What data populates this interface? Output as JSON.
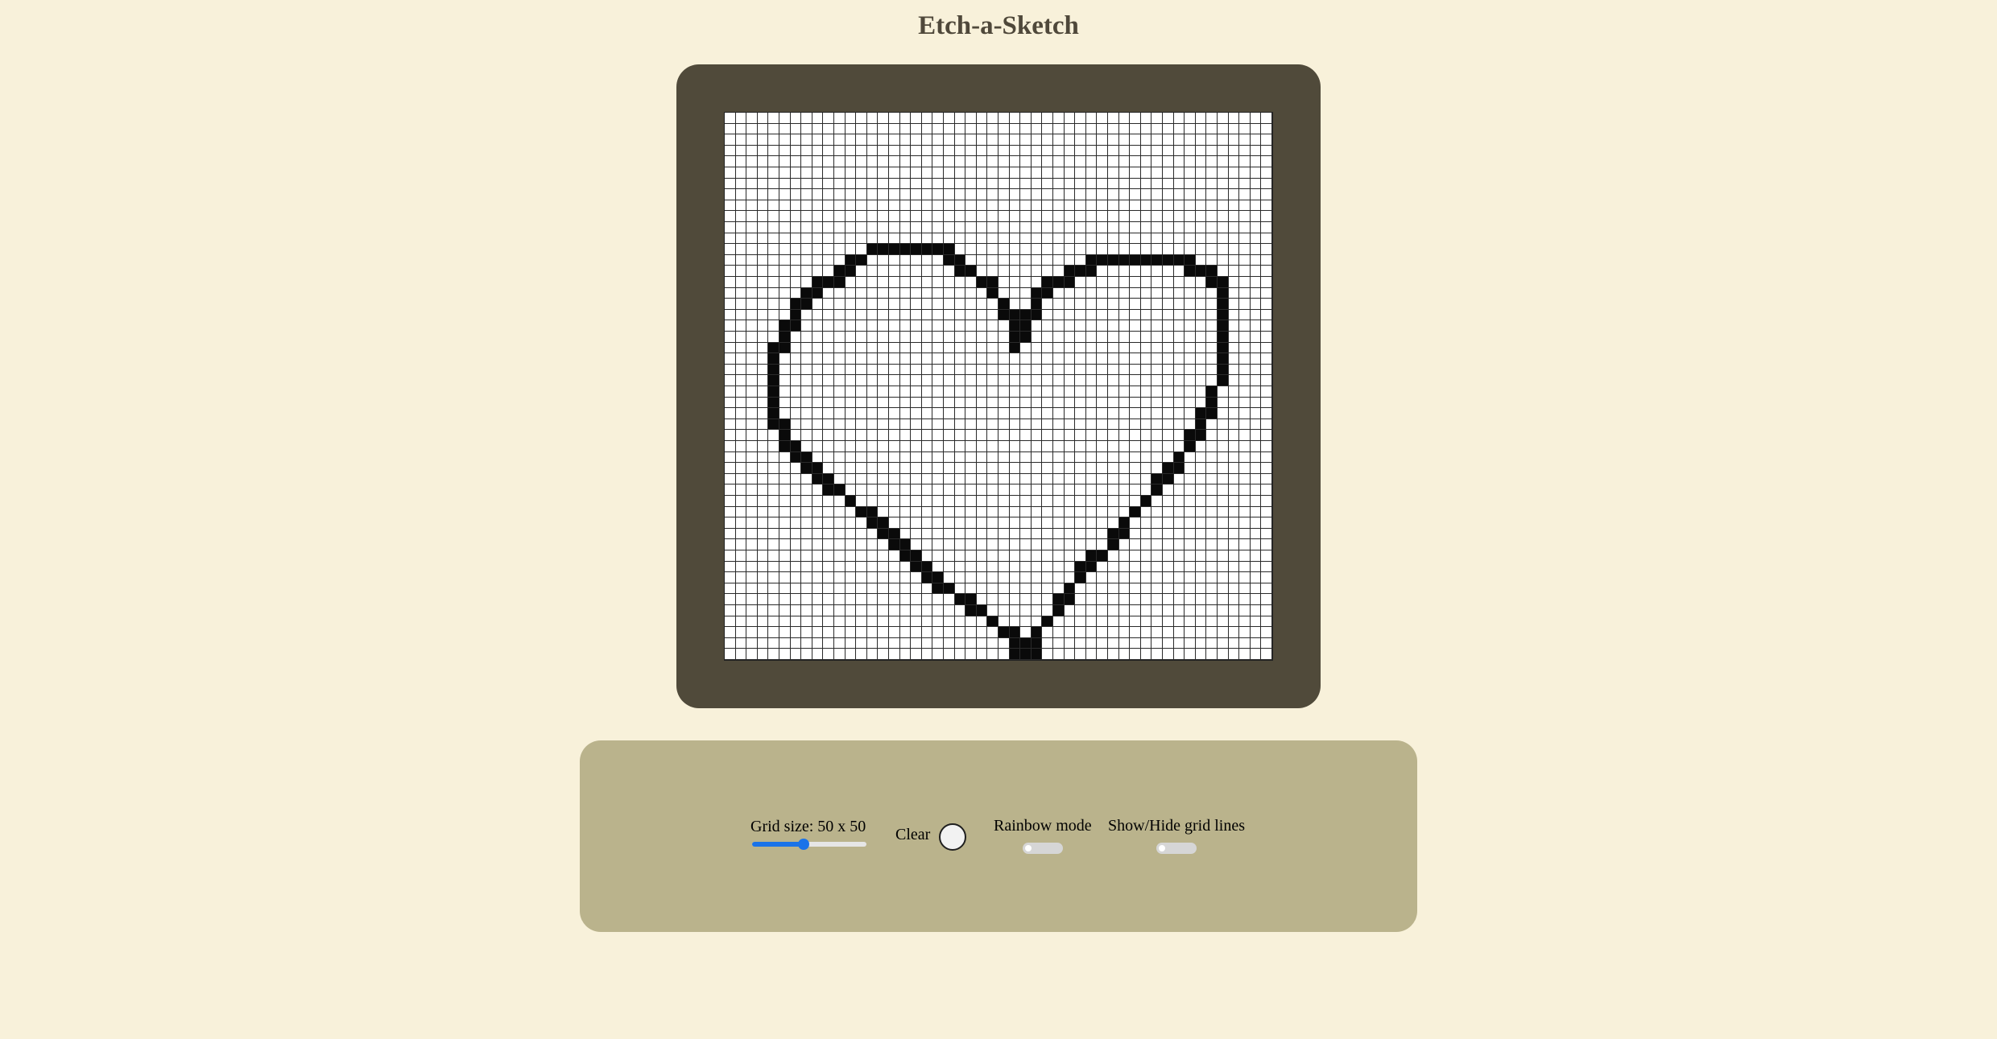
{
  "app": {
    "title": "Etch-a-Sketch"
  },
  "colors": {
    "background": "#f8f1da",
    "frame": "#504a3a",
    "panel": "#bab38c",
    "ink": "#0a0a0a",
    "slider_accent": "#1a73e8"
  },
  "grid": {
    "size": 50,
    "filled_cells": [
      [
        12,
        13
      ],
      [
        12,
        14
      ],
      [
        12,
        15
      ],
      [
        12,
        16
      ],
      [
        12,
        17
      ],
      [
        12,
        18
      ],
      [
        12,
        19
      ],
      [
        12,
        20
      ],
      [
        13,
        11
      ],
      [
        13,
        12
      ],
      [
        13,
        20
      ],
      [
        13,
        21
      ],
      [
        13,
        33
      ],
      [
        13,
        34
      ],
      [
        13,
        35
      ],
      [
        13,
        36
      ],
      [
        13,
        37
      ],
      [
        13,
        38
      ],
      [
        13,
        39
      ],
      [
        13,
        40
      ],
      [
        13,
        41
      ],
      [
        13,
        42
      ],
      [
        14,
        10
      ],
      [
        14,
        11
      ],
      [
        14,
        21
      ],
      [
        14,
        22
      ],
      [
        14,
        31
      ],
      [
        14,
        32
      ],
      [
        14,
        33
      ],
      [
        14,
        42
      ],
      [
        14,
        43
      ],
      [
        14,
        44
      ],
      [
        15,
        8
      ],
      [
        15,
        9
      ],
      [
        15,
        10
      ],
      [
        15,
        23
      ],
      [
        15,
        24
      ],
      [
        15,
        29
      ],
      [
        15,
        30
      ],
      [
        15,
        31
      ],
      [
        15,
        44
      ],
      [
        15,
        45
      ],
      [
        16,
        7
      ],
      [
        16,
        8
      ],
      [
        16,
        24
      ],
      [
        16,
        28
      ],
      [
        16,
        29
      ],
      [
        16,
        45
      ],
      [
        17,
        6
      ],
      [
        17,
        7
      ],
      [
        17,
        25
      ],
      [
        17,
        28
      ],
      [
        17,
        45
      ],
      [
        18,
        6
      ],
      [
        18,
        25
      ],
      [
        18,
        26
      ],
      [
        18,
        27
      ],
      [
        18,
        28
      ],
      [
        18,
        45
      ],
      [
        19,
        5
      ],
      [
        19,
        6
      ],
      [
        19,
        26
      ],
      [
        19,
        27
      ],
      [
        19,
        45
      ],
      [
        20,
        5
      ],
      [
        20,
        26
      ],
      [
        20,
        27
      ],
      [
        20,
        45
      ],
      [
        21,
        4
      ],
      [
        21,
        5
      ],
      [
        21,
        26
      ],
      [
        21,
        45
      ],
      [
        22,
        4
      ],
      [
        22,
        45
      ],
      [
        23,
        4
      ],
      [
        23,
        45
      ],
      [
        24,
        4
      ],
      [
        24,
        45
      ],
      [
        25,
        4
      ],
      [
        25,
        44
      ],
      [
        26,
        4
      ],
      [
        26,
        44
      ],
      [
        27,
        4
      ],
      [
        27,
        43
      ],
      [
        27,
        44
      ],
      [
        28,
        4
      ],
      [
        28,
        5
      ],
      [
        28,
        43
      ],
      [
        29,
        5
      ],
      [
        29,
        42
      ],
      [
        29,
        43
      ],
      [
        30,
        5
      ],
      [
        30,
        6
      ],
      [
        30,
        42
      ],
      [
        31,
        6
      ],
      [
        31,
        7
      ],
      [
        31,
        41
      ],
      [
        32,
        7
      ],
      [
        32,
        8
      ],
      [
        32,
        40
      ],
      [
        32,
        41
      ],
      [
        33,
        8
      ],
      [
        33,
        9
      ],
      [
        33,
        39
      ],
      [
        33,
        40
      ],
      [
        34,
        9
      ],
      [
        34,
        10
      ],
      [
        34,
        39
      ],
      [
        35,
        11
      ],
      [
        35,
        38
      ],
      [
        36,
        12
      ],
      [
        36,
        13
      ],
      [
        36,
        37
      ],
      [
        37,
        13
      ],
      [
        37,
        14
      ],
      [
        37,
        36
      ],
      [
        38,
        14
      ],
      [
        38,
        15
      ],
      [
        38,
        35
      ],
      [
        38,
        36
      ],
      [
        39,
        15
      ],
      [
        39,
        16
      ],
      [
        39,
        35
      ],
      [
        40,
        16
      ],
      [
        40,
        17
      ],
      [
        40,
        33
      ],
      [
        40,
        34
      ],
      [
        41,
        17
      ],
      [
        41,
        18
      ],
      [
        41,
        32
      ],
      [
        41,
        33
      ],
      [
        42,
        18
      ],
      [
        42,
        19
      ],
      [
        42,
        32
      ],
      [
        43,
        19
      ],
      [
        43,
        20
      ],
      [
        43,
        31
      ],
      [
        44,
        21
      ],
      [
        44,
        22
      ],
      [
        44,
        30
      ],
      [
        44,
        31
      ],
      [
        45,
        22
      ],
      [
        45,
        23
      ],
      [
        45,
        30
      ],
      [
        46,
        24
      ],
      [
        46,
        29
      ],
      [
        47,
        25
      ],
      [
        47,
        26
      ],
      [
        47,
        28
      ],
      [
        48,
        26
      ],
      [
        48,
        27
      ],
      [
        48,
        28
      ],
      [
        49,
        26
      ],
      [
        49,
        27
      ],
      [
        49,
        28
      ]
    ]
  },
  "controls": {
    "grid_size_label": "Grid size: 50 x 50",
    "grid_size_slider_fraction": 0.45,
    "clear_label": "Clear",
    "rainbow_label": "Rainbow mode",
    "rainbow_on": false,
    "gridlines_label": "Show/Hide grid lines",
    "gridlines_on": false
  }
}
